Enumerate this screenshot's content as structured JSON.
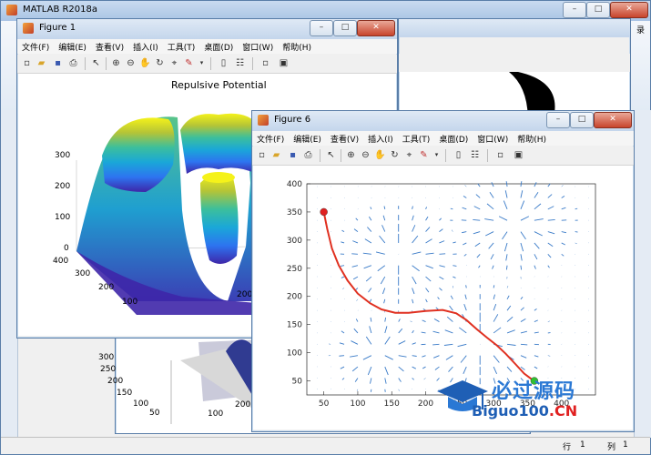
{
  "desktop": {
    "bg": "#6fa0c8"
  },
  "matlab_main": {
    "title": "MATLAB R2018a",
    "partial_right": "录",
    "status_row_label": "行",
    "status_row_value": "1",
    "status_col_label": "列",
    "status_col_value": "1"
  },
  "menus": [
    "文件(F)",
    "编辑(E)",
    "查看(V)",
    "插入(I)",
    "工具(T)",
    "桌面(D)",
    "窗口(W)",
    "帮助(H)"
  ],
  "figure1": {
    "title": "Figure 1",
    "plot_title": "Repulsive Potential",
    "z_ticks": [
      "0",
      "100",
      "200",
      "300"
    ],
    "y_ticks": [
      "100",
      "200",
      "300",
      "400"
    ],
    "x_ticks": [
      "200"
    ]
  },
  "figure_back": {
    "y_ticks": [
      "50",
      "100",
      "150",
      "200",
      "250",
      "300"
    ],
    "x_ticks": [
      "100",
      "200"
    ]
  },
  "figure6": {
    "title": "Figure 6",
    "y_ticks": [
      "50",
      "100",
      "150",
      "200",
      "250",
      "300",
      "350",
      "400"
    ],
    "x_ticks": [
      "50",
      "100",
      "150",
      "200",
      "250",
      "300",
      "350",
      "400"
    ]
  },
  "watermark": {
    "brand_cn": "必过源码",
    "brand_en": "Biguo100",
    "brand_suffix": ".CN"
  },
  "chart_data": [
    {
      "type": "surface",
      "title": "Repulsive Potential",
      "zlim": [
        0,
        300
      ],
      "ylim": [
        0,
        400
      ],
      "colormap": "parula"
    },
    {
      "type": "line",
      "xlabel": "",
      "ylabel": "",
      "xlim": [
        25,
        450
      ],
      "ylim": [
        25,
        400
      ],
      "series": [
        {
          "x": [
            50,
            55,
            62,
            72,
            85,
            100,
            118,
            135,
            155,
            175,
            200,
            225,
            245,
            260,
            275,
            290,
            305,
            318,
            332,
            345,
            355,
            362
          ],
          "y": [
            350,
            320,
            285,
            255,
            228,
            205,
            188,
            177,
            171,
            171,
            174,
            176,
            170,
            158,
            142,
            127,
            113,
            98,
            80,
            63,
            54,
            50
          ],
          "color": "#e03020"
        }
      ],
      "markers": [
        {
          "label": "start",
          "x": 50,
          "y": 350,
          "color": "#e02020"
        },
        {
          "label": "goal",
          "x": 360,
          "y": 50,
          "color": "#30c030"
        }
      ],
      "quiver_color": "#3a7bc8"
    }
  ]
}
